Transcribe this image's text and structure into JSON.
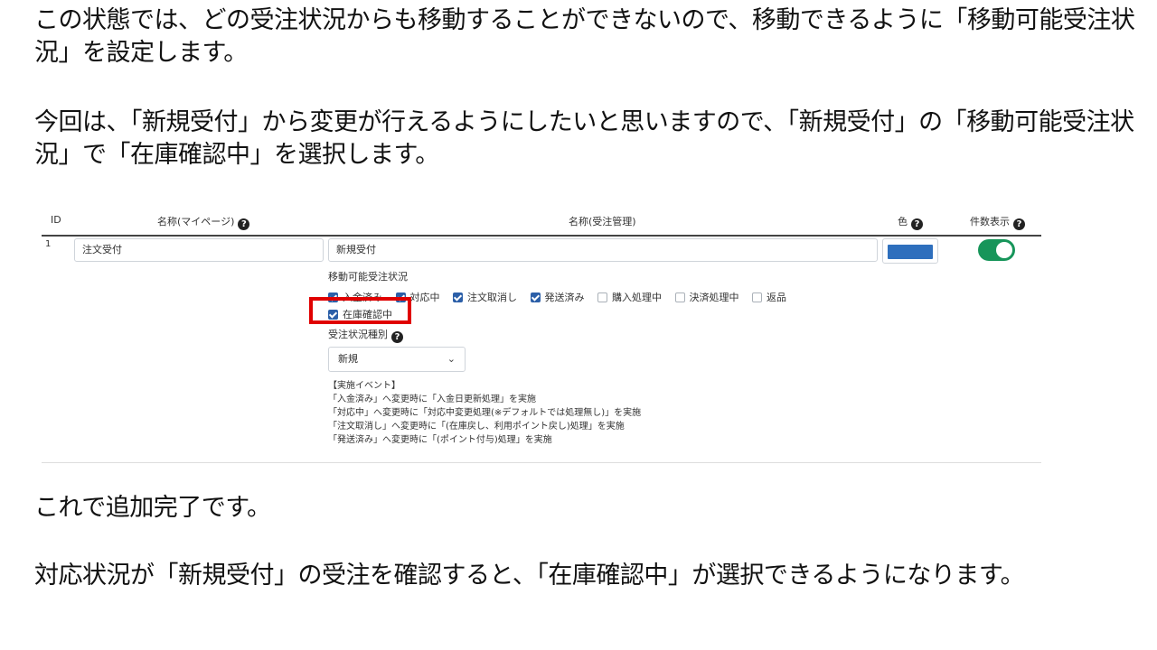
{
  "text": {
    "p1": "この状態では、どの受注状況からも移動することができないので、移動できるように「移動可能受注状況」を設定します。",
    "p2": "今回は、「新規受付」から変更が行えるようにしたいと思いますので、「新規受付」の「移動可能受注状況」で「在庫確認中」を選択します。",
    "p3": "これで追加完了です。",
    "p4": "対応状況が「新規受付」の受注を確認すると、「在庫確認中」が選択できるようになります。"
  },
  "table": {
    "headers": {
      "id": "ID",
      "name_mypage": "名称(マイページ)",
      "name_admin": "名称(受注管理)",
      "color": "色",
      "count_display": "件数表示"
    },
    "row": {
      "id": "1",
      "name_mypage": "注文受付",
      "name_admin": "新規受付",
      "color": "#2e6fbd",
      "count_display_enabled": true,
      "movable_label": "移動可能受注状況",
      "movable_options": [
        {
          "label": "入金済み",
          "checked": true
        },
        {
          "label": "対応中",
          "checked": true
        },
        {
          "label": "注文取消し",
          "checked": true
        },
        {
          "label": "発送済み",
          "checked": true
        },
        {
          "label": "購入処理中",
          "checked": false
        },
        {
          "label": "決済処理中",
          "checked": false
        },
        {
          "label": "返品",
          "checked": false
        }
      ],
      "highlighted_option": {
        "label": "在庫確認中",
        "checked": true
      },
      "type_label": "受注状況種別",
      "type_value": "新規",
      "events_title": "【実施イベント】",
      "events": [
        "「入金済み」へ変更時に「入金日更新処理」を実施",
        "「対応中」へ変更時に「対応中変更処理(※デフォルトでは処理無し)」を実施",
        "「注文取消し」へ変更時に「(在庫戻し、利用ポイント戻し)処理」を実施",
        "「発送済み」へ変更時に「(ポイント付与)処理」を実施"
      ]
    }
  },
  "colors": {
    "highlight": "#e00000",
    "toggle_on": "#17955a",
    "checkbox_checked": "#2c5fa8"
  }
}
